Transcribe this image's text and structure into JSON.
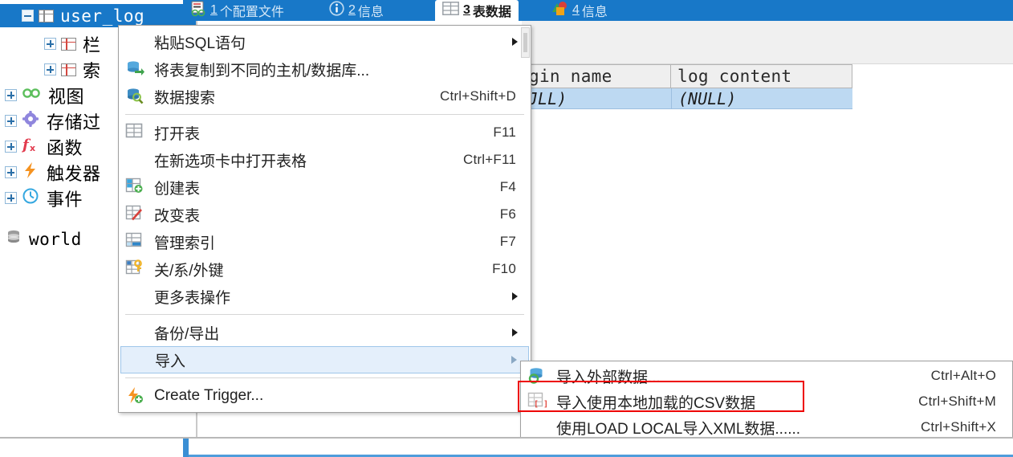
{
  "app": {
    "selected_tree_node": "user_log",
    "accent_blue": "#1878c8",
    "highlight_red": "#ee0000",
    "menu_highlight": "#e4effb"
  },
  "tabs": [
    {
      "num": "1",
      "label": "个配置文件",
      "icon": "profile-icon",
      "active": false
    },
    {
      "num": "2",
      "label": "信息",
      "icon": "info-icon",
      "active": false
    },
    {
      "num": "3",
      "label": "表数据",
      "icon": "table-icon",
      "active": true
    },
    {
      "num": "4",
      "label": "信息",
      "icon": "chart-icon",
      "active": false
    }
  ],
  "tree": {
    "items": [
      {
        "label": "user_log",
        "icon": "table-icon",
        "expander": "minus",
        "selected": true,
        "indent": 0
      },
      {
        "label": "栏",
        "icon": "columns-icon",
        "expander": "plus",
        "selected": false,
        "indent": 1
      },
      {
        "label": "索",
        "icon": "index-icon",
        "expander": "plus",
        "selected": false,
        "indent": 1
      },
      {
        "label": "视图",
        "icon": "view-icon",
        "expander": "plus",
        "selected": false,
        "indent": 0
      },
      {
        "label": "存储过",
        "icon": "procedure-icon",
        "expander": "plus",
        "selected": false,
        "indent": 0
      },
      {
        "label": "函数",
        "icon": "function-icon",
        "expander": "plus",
        "selected": false,
        "indent": 0
      },
      {
        "label": "触发器",
        "icon": "trigger-icon",
        "expander": "plus",
        "selected": false,
        "indent": 0
      },
      {
        "label": "事件",
        "icon": "event-icon",
        "expander": "plus",
        "selected": false,
        "indent": 0
      },
      {
        "label": "world",
        "icon": "database-icon",
        "expander": "none",
        "selected": false,
        "indent": 0
      }
    ]
  },
  "grid": {
    "columns": [
      "gin name",
      "log content"
    ],
    "rows": [
      [
        "JLL)",
        "(NULL)"
      ]
    ]
  },
  "context_menu": {
    "items": [
      {
        "label": "粘贴SQL语句",
        "accel": "",
        "icon": "",
        "submenu": true,
        "highlight": false
      },
      {
        "label": "将表复制到不同的主机/数据库...",
        "accel": "",
        "icon": "copy-db-icon",
        "submenu": false,
        "highlight": false
      },
      {
        "label": "数据搜索",
        "accel": "Ctrl+Shift+D",
        "icon": "data-search-icon",
        "submenu": false,
        "highlight": false
      },
      {
        "separator": true
      },
      {
        "label": "打开表",
        "accel": "F11",
        "icon": "open-table-icon",
        "submenu": false,
        "highlight": false
      },
      {
        "label": "在新选项卡中打开表格",
        "accel": "Ctrl+F11",
        "icon": "",
        "submenu": false,
        "highlight": false
      },
      {
        "label": "创建表",
        "accel": "F4",
        "icon": "create-table-icon",
        "submenu": false,
        "highlight": false
      },
      {
        "label": "改变表",
        "accel": "F6",
        "icon": "alter-table-icon",
        "submenu": false,
        "highlight": false
      },
      {
        "label": "管理索引",
        "accel": "F7",
        "icon": "manage-index-icon",
        "submenu": false,
        "highlight": false
      },
      {
        "label": "关/系/外键",
        "accel": "F10",
        "icon": "foreign-key-icon",
        "submenu": false,
        "highlight": false
      },
      {
        "label": "更多表操作",
        "accel": "",
        "icon": "",
        "submenu": true,
        "highlight": false
      },
      {
        "separator": true
      },
      {
        "label": "备份/导出",
        "accel": "",
        "icon": "",
        "submenu": true,
        "highlight": false
      },
      {
        "label": "导入",
        "accel": "",
        "icon": "",
        "submenu": true,
        "highlight": true
      },
      {
        "separator": true
      },
      {
        "label": "Create Trigger...",
        "accel": "",
        "icon": "create-trigger-icon",
        "submenu": false,
        "highlight": false
      }
    ]
  },
  "submenu": {
    "items": [
      {
        "label": "导入外部数据...",
        "accel": "Ctrl+Alt+O",
        "icon": "import-external-icon",
        "boxed": false
      },
      {
        "label": "导入使用本地加载的CSV数据",
        "accel": "Ctrl+Shift+M",
        "icon": "import-csv-icon",
        "boxed": true
      },
      {
        "label": "使用LOAD LOCAL导入XML数据......",
        "accel": "Ctrl+Shift+X",
        "icon": "",
        "boxed": false
      }
    ]
  }
}
